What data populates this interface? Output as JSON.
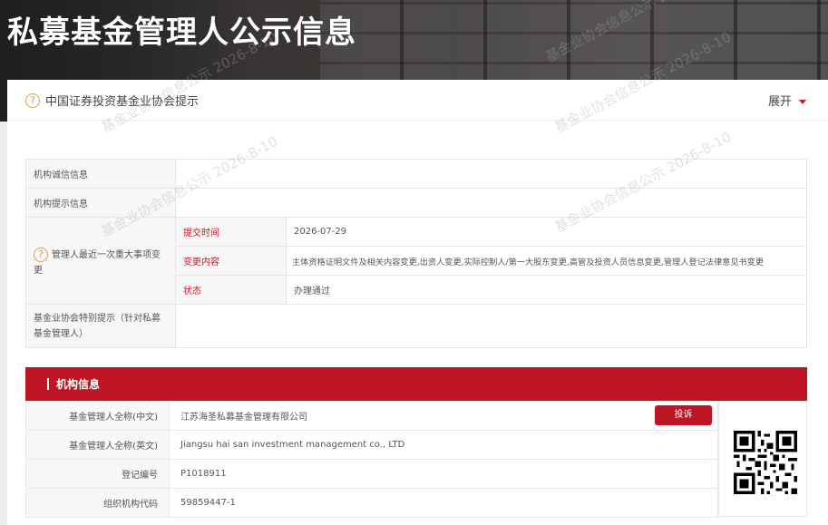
{
  "header": {
    "title": "私募基金管理人公示信息"
  },
  "tip": {
    "text": "中国证券投资基金业协会提示",
    "expand_label": "展开"
  },
  "info_table": {
    "credit_label": "机构诚信信息",
    "notice_label": "机构提示信息",
    "change_label": "管理人最近一次重大事项变更",
    "submit_time_label": "提交时间",
    "submit_time_value": "2026-07-29",
    "change_content_label": "变更内容",
    "change_content_value": "主体资格证明文件及相关内容变更,出资人变更,实际控制人/第一大股东变更,高管及投资人员信息变更,管理人登记法律意见书变更",
    "status_label": "状态",
    "status_value": "办理通过",
    "special_tip_label": "基金业协会特别提示（针对私募基金管理人）"
  },
  "org": {
    "section_title": "机构信息",
    "complain_label": "投诉",
    "rows": [
      {
        "label": "基金管理人全称(中文)",
        "value": "江苏海圣私募基金管理有限公司"
      },
      {
        "label": "基金管理人全称(英文)",
        "value": "Jiangsu hai san investment management co., LTD"
      },
      {
        "label": "登记编号",
        "value": "P1018911"
      },
      {
        "label": "组织机构代码",
        "value": "59859447-1"
      }
    ]
  },
  "watermark": {
    "text": "基金业协会信息公示 2026-8-10"
  },
  "colors": {
    "brand_red": "#bd1622",
    "label_bg": "#f7f7f7",
    "hint_orange": "#d9a04a"
  }
}
